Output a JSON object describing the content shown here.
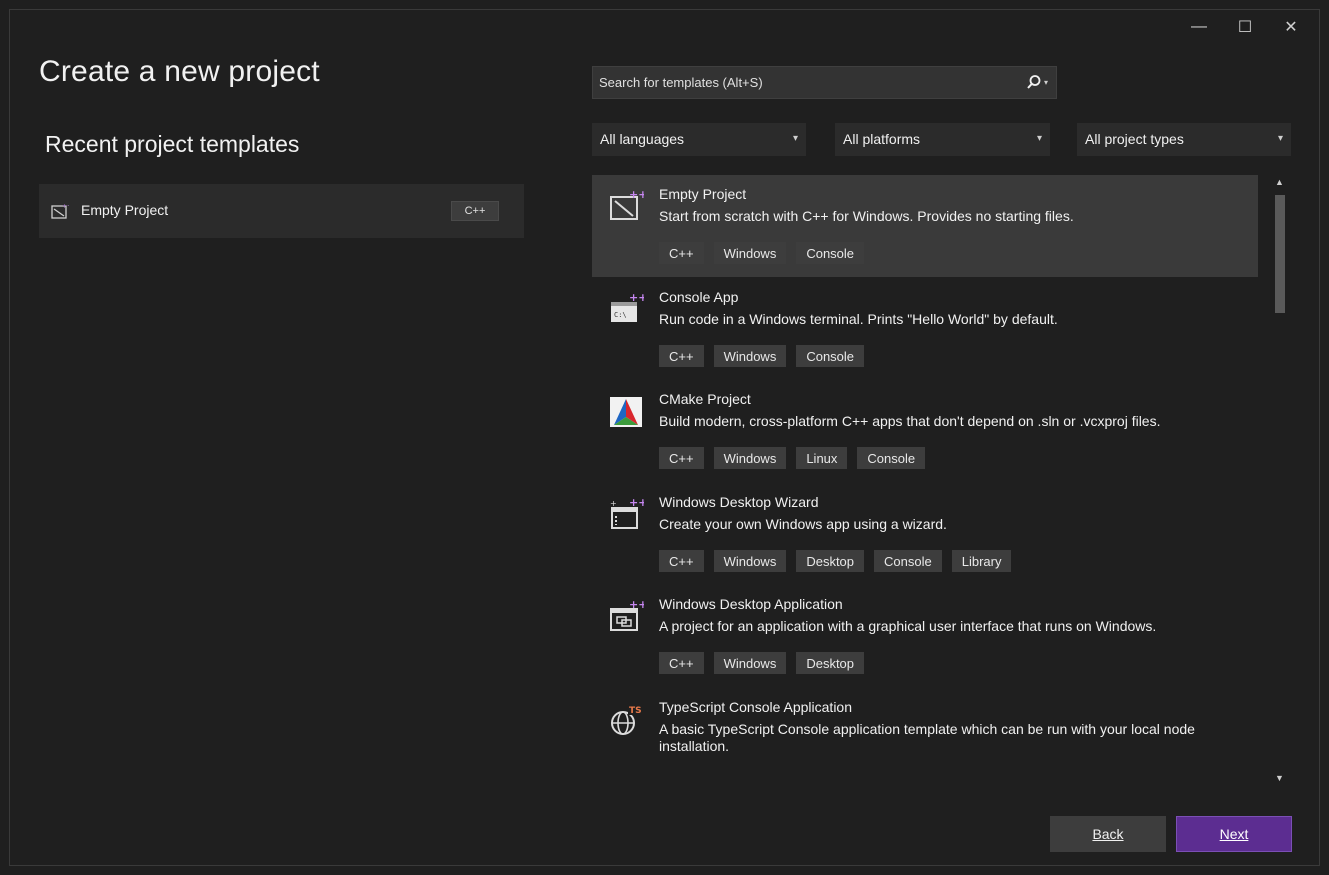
{
  "window": {
    "minimize_icon": "minimize-icon",
    "maximize_icon": "maximize-icon",
    "close_icon": "close-icon"
  },
  "title": "Create a new project",
  "recent": {
    "heading": "Recent project templates",
    "items": [
      {
        "label": "Empty Project",
        "tag": "C++",
        "icon": "empty-project-icon"
      }
    ]
  },
  "search": {
    "placeholder": "Search for templates (Alt+S)",
    "icon": "search-icon"
  },
  "filters": {
    "languages": "All languages",
    "platforms": "All platforms",
    "project_types": "All project types"
  },
  "templates": [
    {
      "name": "Empty Project",
      "description": "Start from scratch with C++ for Windows. Provides no starting files.",
      "tags": [
        "C++",
        "Windows",
        "Console"
      ],
      "icon": "empty-project-icon",
      "selected": true
    },
    {
      "name": "Console App",
      "description": "Run code in a Windows terminal. Prints \"Hello World\" by default.",
      "tags": [
        "C++",
        "Windows",
        "Console"
      ],
      "icon": "console-app-icon",
      "selected": false
    },
    {
      "name": "CMake Project",
      "description": "Build modern, cross-platform C++ apps that don't depend on .sln or .vcxproj files.",
      "tags": [
        "C++",
        "Windows",
        "Linux",
        "Console"
      ],
      "icon": "cmake-icon",
      "selected": false
    },
    {
      "name": "Windows Desktop Wizard",
      "description": "Create your own Windows app using a wizard.",
      "tags": [
        "C++",
        "Windows",
        "Desktop",
        "Console",
        "Library"
      ],
      "icon": "wizard-icon",
      "selected": false
    },
    {
      "name": "Windows Desktop Application",
      "description": "A project for an application with a graphical user interface that runs on Windows.",
      "tags": [
        "C++",
        "Windows",
        "Desktop"
      ],
      "icon": "desktop-app-icon",
      "selected": false
    },
    {
      "name": "TypeScript Console Application",
      "description": "A basic TypeScript Console application template which can be run with your local node installation.",
      "tags": [],
      "icon": "typescript-icon",
      "selected": false
    }
  ],
  "buttons": {
    "back": "Back",
    "next": "Next"
  },
  "colors": {
    "background": "#1f1f1f",
    "panel": "#2b2b2b",
    "selected_row": "#3a3a3a",
    "tag": "#3d3d3d",
    "accent": "#5c2d91"
  }
}
